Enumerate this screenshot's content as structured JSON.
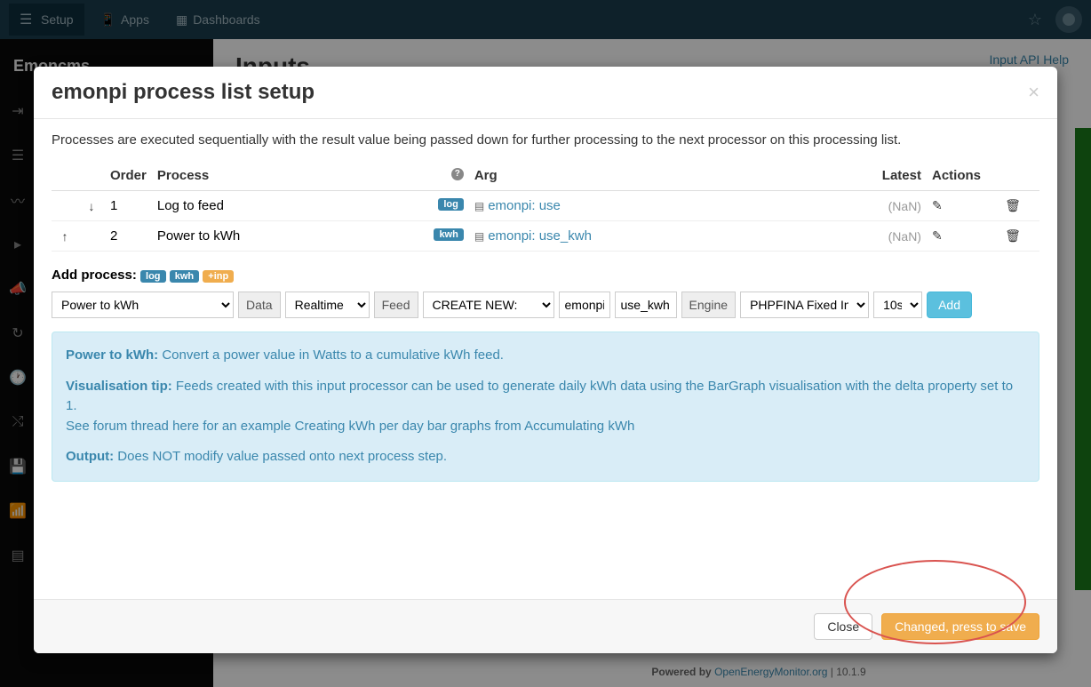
{
  "topbar": {
    "setup": "Setup",
    "apps": "Apps",
    "dashboards": "Dashboards"
  },
  "sidebar": {
    "brand": "Emoncms"
  },
  "page": {
    "title": "Inputs",
    "api_help": "Input API Help"
  },
  "modal": {
    "title": "emonpi process list setup",
    "description": "Processes are executed sequentially with the result value being passed down for further processing to the next processor on this processing list.",
    "columns": {
      "order": "Order",
      "process": "Process",
      "arg": "Arg",
      "latest": "Latest",
      "actions": "Actions"
    },
    "rows": [
      {
        "order": "1",
        "process": "Log to feed",
        "badge": "log",
        "feed": "emonpi: use",
        "latest": "(NaN)"
      },
      {
        "order": "2",
        "process": "Power to kWh",
        "badge": "kwh",
        "feed": "emonpi: use_kwh",
        "latest": "(NaN)"
      }
    ],
    "add_process_label": "Add process:",
    "badges": {
      "log": "log",
      "kwh": "kwh",
      "inp": "+inp"
    },
    "form": {
      "process_select": "Power to kWh",
      "data_label": "Data",
      "data_select": "Realtime",
      "feed_label": "Feed",
      "feed_select": "CREATE NEW:",
      "tag_input": "emonpi",
      "name_input": "use_kwh",
      "engine_label": "Engine",
      "engine_select": "PHPFINA Fixed Interval",
      "interval_select": "10s",
      "add_button": "Add"
    },
    "info": {
      "p1_bold": "Power to kWh:",
      "p1_text": " Convert a power value in Watts to a cumulative kWh feed.",
      "p2_bold": "Visualisation tip:",
      "p2_text": " Feeds created with this input processor can be used to generate daily kWh data using the BarGraph visualisation with the delta property set to 1.",
      "p2_line2": "See forum thread here for an example ",
      "p2_link": "Creating kWh per day bar graphs from Accumulating kWh",
      "p3_bold": "Output:",
      "p3_text": " Does NOT modify value passed onto next process step."
    },
    "footer": {
      "close": "Close",
      "save": "Changed, press to save"
    }
  },
  "footer": {
    "powered": "Powered by ",
    "link": "OpenEnergyMonitor.org",
    "version": " | 10.1.9"
  }
}
